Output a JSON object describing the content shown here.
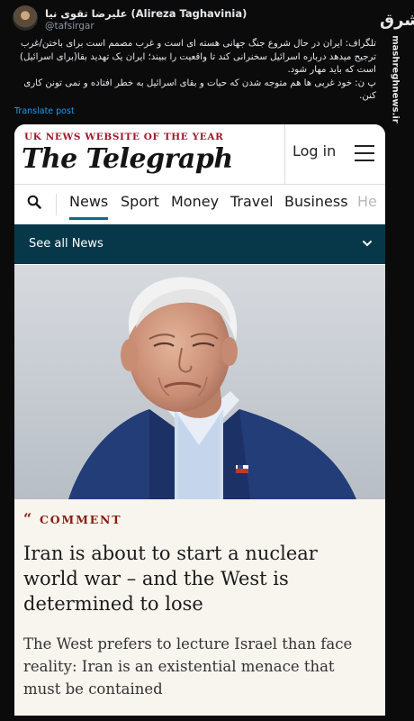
{
  "tweet": {
    "display_name": "علیرضا تقوی نیا (Alireza Taghavinia)",
    "handle": "@tafsirgar",
    "text_lines": [
      "تلگراف: ایران در حال شروع جنگ جهانی هسته ای است و غرب مصمم است برای باختن/غرب ترجیح میدهد درباره اسرائیل سخنرانی کند تا واقعیت را ببیند؛ ایران یک تهدید بقا(برای اسرائیل) است که باید مهار شود.",
      "پ ن: خود غربی ها هم متوجه شدن که حیات و بقای اسرائیل به خطر افتاده و نمی تونن کاری کنن."
    ],
    "translate_label": "Translate post"
  },
  "watermark": {
    "logo_text": "مشرق",
    "url": "mashreghnews.ir"
  },
  "telegraph": {
    "award": "UK NEWS WEBSITE OF THE YEAR",
    "brand": "The Telegraph",
    "login_label": "Log in",
    "nav": [
      "News",
      "Sport",
      "Money",
      "Travel",
      "Business",
      "He"
    ],
    "active_nav": "News",
    "see_all_label": "See all News"
  },
  "article": {
    "quote_mark": "“",
    "section_label": "COMMENT",
    "headline": "Iran is about to start a nuclear world war – and the West is determined to lose",
    "standfirst": "The West prefers to lecture Israel than face reality: Iran is an existential menace that must be contained"
  },
  "colors": {
    "telegraph_red": "#a0182a",
    "nav_active": "#0b6b85",
    "see_all_bg": "#06384a",
    "comment_red": "#8a1d10",
    "twitter_blue": "#1d9bf0"
  }
}
